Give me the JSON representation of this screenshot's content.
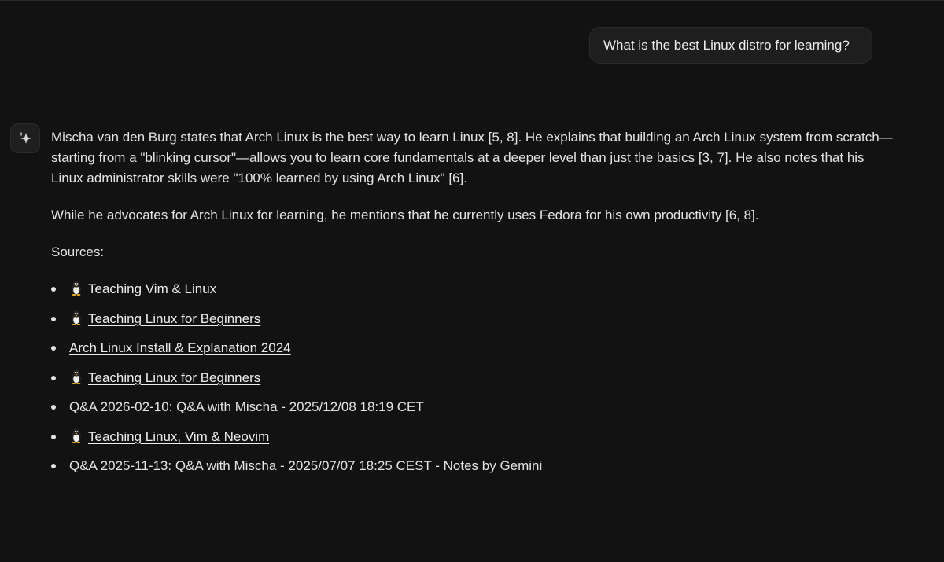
{
  "user_message": "What is the best Linux distro for learning?",
  "assistant": {
    "avatar_icon": "sparkle-icon",
    "paragraphs": [
      "Mischa van den Burg states that Arch Linux is the best way to learn Linux [5, 8]. He explains that building an Arch Linux system from scratch—starting from a \"blinking cursor\"—allows you to learn core fundamentals at a deeper level than just the basics [3, 7]. He also notes that his Linux administrator skills were \"100% learned by using Arch Linux\" [6].",
      "While he advocates for Arch Linux for learning, he mentions that he currently uses Fedora for his own productivity [6, 8]."
    ],
    "sources_heading": "Sources:",
    "sources": [
      {
        "label": "Teaching Vim & Linux",
        "icon": "penguin-icon",
        "link": true
      },
      {
        "label": "Teaching Linux for Beginners",
        "icon": "penguin-icon",
        "link": true
      },
      {
        "label": "Arch Linux Install & Explanation 2024",
        "icon": "",
        "link": true
      },
      {
        "label": "Teaching Linux for Beginners",
        "icon": "penguin-icon",
        "link": true
      },
      {
        "label": "Q&A 2026-02-10: Q&A with Mischa - 2025/12/08 18:19 CET",
        "icon": "",
        "link": false
      },
      {
        "label": "Teaching Linux, Vim & Neovim",
        "icon": "penguin-icon",
        "link": true
      },
      {
        "label": "Q&A 2025-11-13: Q&A with Mischa - 2025/07/07 18:25 CEST - Notes by Gemini",
        "icon": "",
        "link": false
      }
    ]
  }
}
